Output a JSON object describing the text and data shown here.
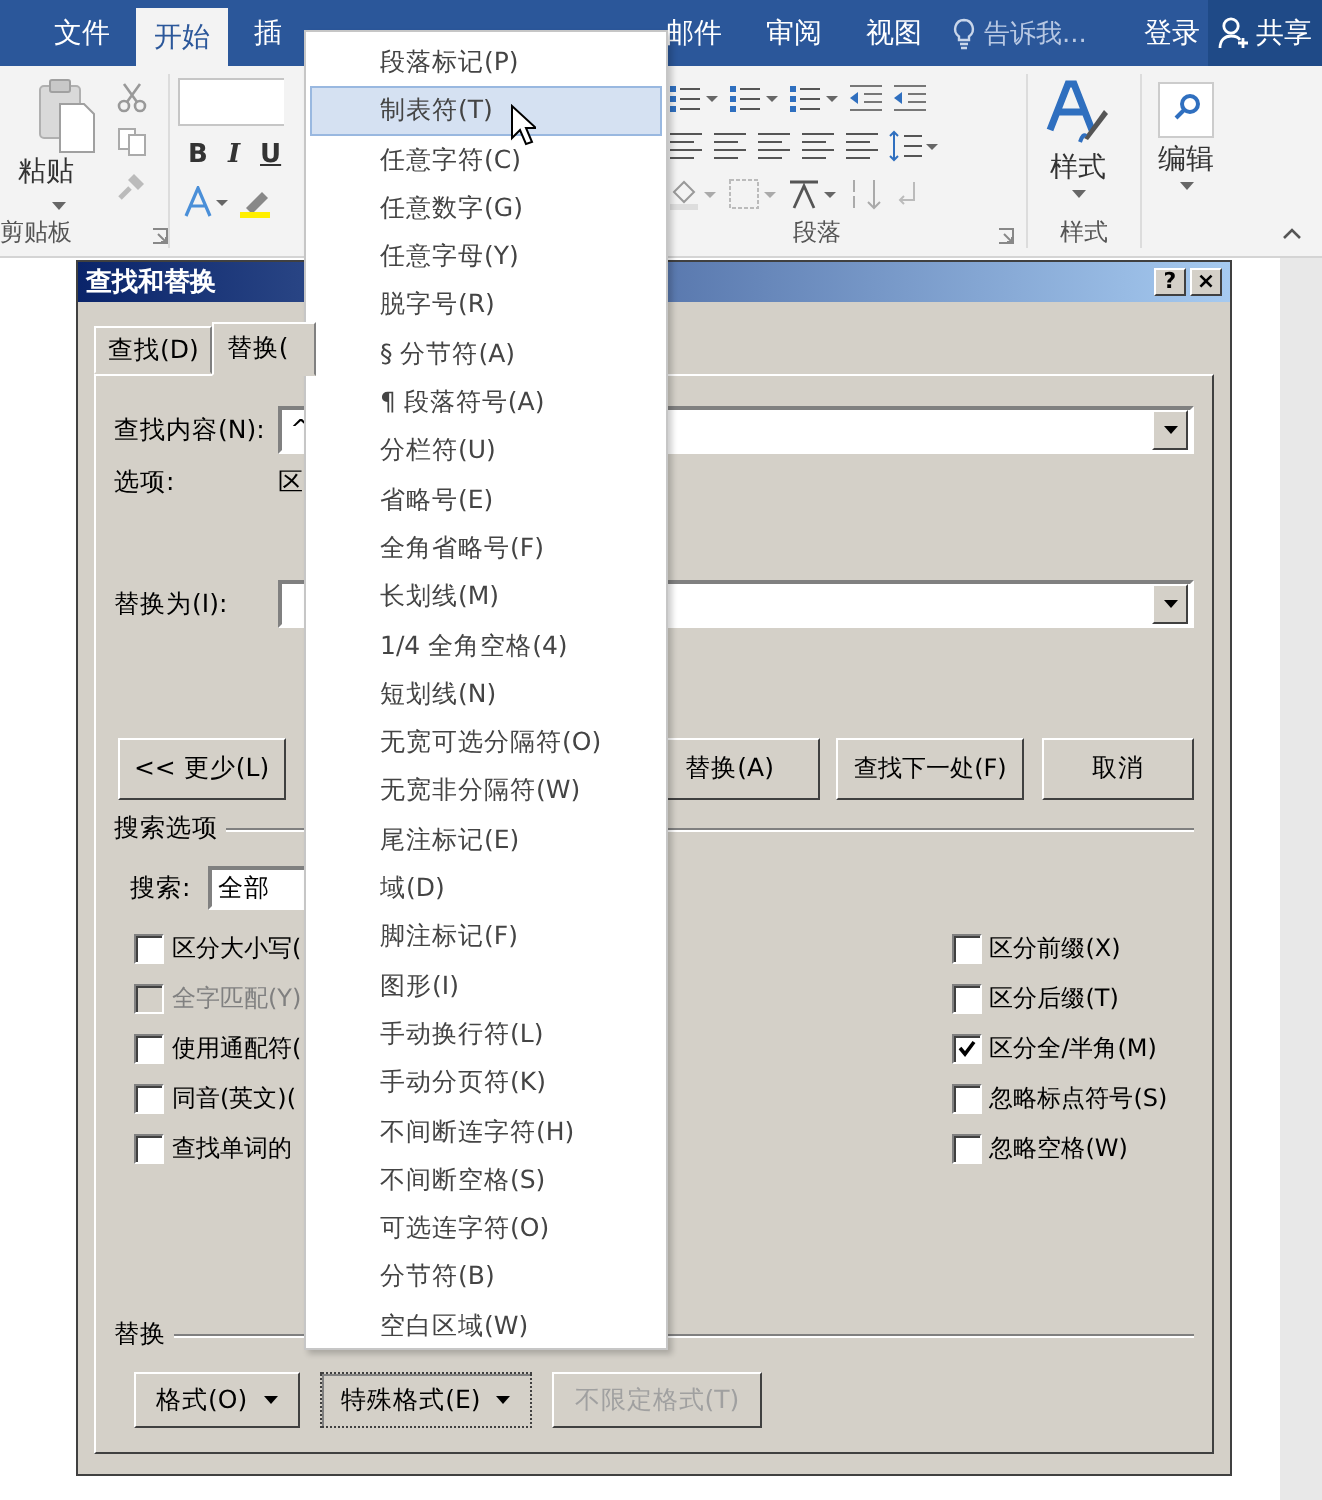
{
  "ribbon": {
    "tabs": [
      {
        "label": "文件",
        "selected": false
      },
      {
        "label": "开始",
        "selected": true
      },
      {
        "label": "插",
        "selected": false
      },
      {
        "label": "邮件",
        "selected": false
      },
      {
        "label": "审阅",
        "selected": false
      },
      {
        "label": "视图",
        "selected": false
      }
    ],
    "tell_me": "告诉我...",
    "sign_in": "登录",
    "share": "共享",
    "paste": "粘贴",
    "font_buttons": [
      "B",
      "I",
      "U"
    ],
    "group_labels": {
      "clipboard": "剪贴板",
      "paragraph": "段落",
      "styles": "样式"
    },
    "styles_button": "样式",
    "editing_button": "编辑"
  },
  "dialog": {
    "title": "查找和替换",
    "help": "?",
    "close": "×",
    "tabs": [
      {
        "label": "查找(D)",
        "selected": false
      },
      {
        "label": "替换(",
        "selected": true
      }
    ],
    "find_label": "查找内容(N):",
    "find_value": "^",
    "options_label": "选项:",
    "options_value": "区",
    "replace_label": "替换为(I):",
    "buttons": [
      {
        "label": "<< 更少(L)"
      },
      {
        "label": "替换(A)"
      },
      {
        "label": "查找下一处(F)"
      },
      {
        "label": "取消"
      }
    ],
    "search_options_title": "搜索选项",
    "search_label": "搜索:",
    "search_value": "全部",
    "left_options": [
      {
        "label": "区分大小写(",
        "checked": false,
        "disabled": false
      },
      {
        "label": "全字匹配(Y)",
        "checked": false,
        "disabled": true
      },
      {
        "label": "使用通配符(",
        "checked": false,
        "disabled": false
      },
      {
        "label": "同音(英文)(",
        "checked": false,
        "disabled": false
      },
      {
        "label": "查找单词的",
        "checked": false,
        "disabled": false
      }
    ],
    "right_options": [
      {
        "label": "区分前缀(X)",
        "checked": false,
        "disabled": false
      },
      {
        "label": "区分后缀(T)",
        "checked": false,
        "disabled": false
      },
      {
        "label": "区分全/半角(M)",
        "checked": true,
        "disabled": false
      },
      {
        "label": "忽略标点符号(S)",
        "checked": false,
        "disabled": false
      },
      {
        "label": "忽略空格(W)",
        "checked": false,
        "disabled": false
      }
    ],
    "replace_section_title": "替换",
    "replace_buttons": [
      {
        "label": "格式(O)",
        "dropdown": true,
        "pressed": false,
        "disabled": false
      },
      {
        "label": "特殊格式(E)",
        "dropdown": true,
        "pressed": true,
        "disabled": false
      },
      {
        "label": "不限定格式(T)",
        "dropdown": false,
        "pressed": false,
        "disabled": true
      }
    ]
  },
  "menu": {
    "items": [
      {
        "label": "段落标记(P)",
        "selected": false
      },
      {
        "label": "制表符(T)",
        "selected": true
      },
      {
        "label": "任意字符(C)",
        "selected": false
      },
      {
        "label": "任意数字(G)",
        "selected": false
      },
      {
        "label": "任意字母(Y)",
        "selected": false
      },
      {
        "label": "脱字号(R)",
        "selected": false
      },
      {
        "label": "§ 分节符(A)",
        "selected": false
      },
      {
        "label": "¶ 段落符号(A)",
        "selected": false
      },
      {
        "label": "分栏符(U)",
        "selected": false
      },
      {
        "label": "省略号(E)",
        "selected": false
      },
      {
        "label": "全角省略号(F)",
        "selected": false
      },
      {
        "label": "长划线(M)",
        "selected": false
      },
      {
        "label": "1/4 全角空格(4)",
        "selected": false
      },
      {
        "label": "短划线(N)",
        "selected": false
      },
      {
        "label": "无宽可选分隔符(O)",
        "selected": false
      },
      {
        "label": "无宽非分隔符(W)",
        "selected": false
      },
      {
        "label": "尾注标记(E)",
        "selected": false
      },
      {
        "label": "域(D)",
        "selected": false
      },
      {
        "label": "脚注标记(F)",
        "selected": false
      },
      {
        "label": "图形(I)",
        "selected": false
      },
      {
        "label": "手动换行符(L)",
        "selected": false
      },
      {
        "label": "手动分页符(K)",
        "selected": false
      },
      {
        "label": "不间断连字符(H)",
        "selected": false
      },
      {
        "label": "不间断空格(S)",
        "selected": false
      },
      {
        "label": "可选连字符(O)",
        "selected": false
      },
      {
        "label": "分节符(B)",
        "selected": false
      },
      {
        "label": "空白区域(W)",
        "selected": false
      }
    ]
  }
}
